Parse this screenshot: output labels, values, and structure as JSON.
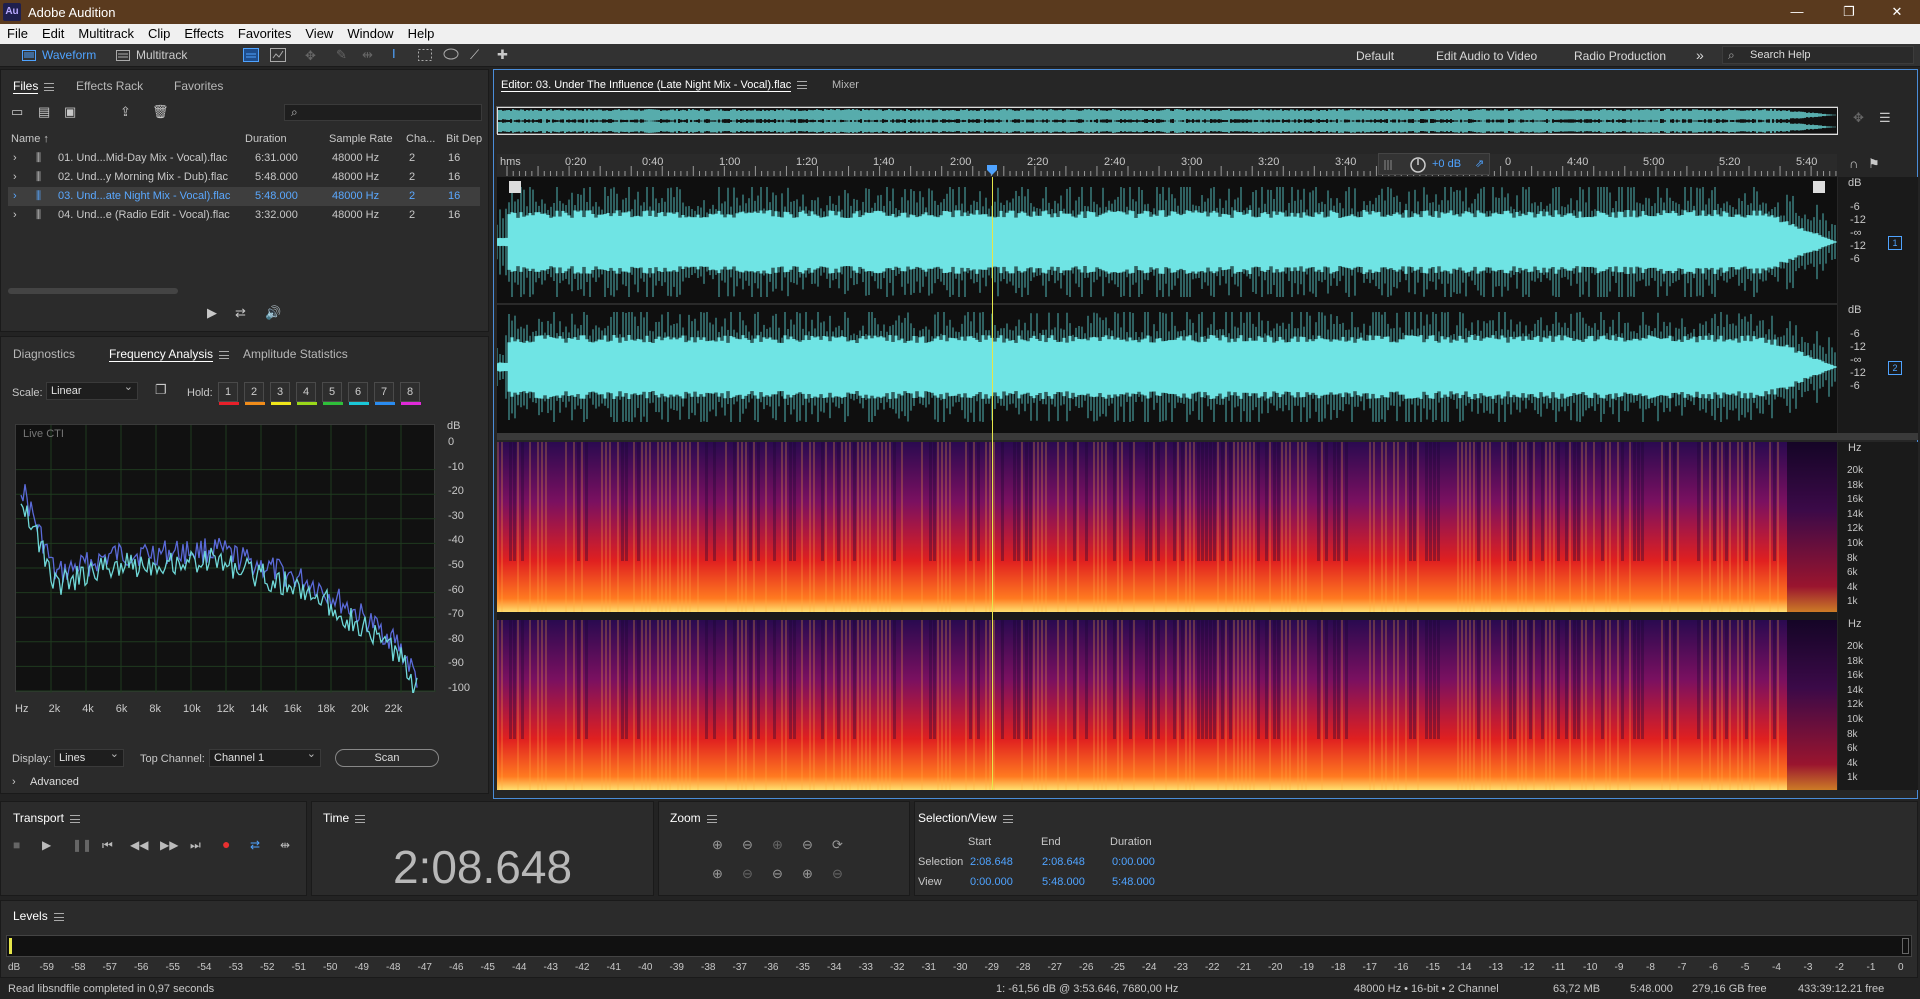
{
  "app": {
    "title": "Adobe Audition",
    "icon_text": "Au"
  },
  "window_controls": [
    "—",
    "❐",
    "✕"
  ],
  "menu": [
    "File",
    "Edit",
    "Multitrack",
    "Clip",
    "Effects",
    "Favorites",
    "View",
    "Window",
    "Help"
  ],
  "toolbar": {
    "waveform_label": "Waveform",
    "multitrack_label": "Multitrack",
    "workspaces": [
      "Default",
      "Edit Audio to Video",
      "Radio Production"
    ],
    "overflow": "»",
    "search_placeholder": "Search Help"
  },
  "files_panel": {
    "tabs": [
      "Files",
      "Effects Rack",
      "Favorites"
    ],
    "columns": [
      "Name ↑",
      "Duration",
      "Sample Rate",
      "Cha...",
      "Bit Dep"
    ],
    "rows": [
      {
        "name": "01. Und...Mid-Day Mix - Vocal).flac",
        "duration": "6:31.000",
        "rate": "48000 Hz",
        "ch": "2",
        "bits": "16",
        "selected": false
      },
      {
        "name": "02. Und...y Morning Mix - Dub).flac",
        "duration": "5:48.000",
        "rate": "48000 Hz",
        "ch": "2",
        "bits": "16",
        "selected": false
      },
      {
        "name": "03. Und...ate Night Mix - Vocal).flac",
        "duration": "5:48.000",
        "rate": "48000 Hz",
        "ch": "2",
        "bits": "16",
        "selected": true
      },
      {
        "name": "04. Und...e (Radio Edit - Vocal).flac",
        "duration": "3:32.000",
        "rate": "48000 Hz",
        "ch": "2",
        "bits": "16",
        "selected": false
      }
    ]
  },
  "analysis_panel": {
    "tabs": [
      "Diagnostics",
      "Frequency Analysis",
      "Amplitude Statistics"
    ],
    "scale_label": "Scale:",
    "scale_value": "Linear",
    "hold_label": "Hold:",
    "hold_buttons": [
      "1",
      "2",
      "3",
      "4",
      "5",
      "6",
      "7",
      "8"
    ],
    "hold_colors": [
      "#e8202a",
      "#f08c1a",
      "#f0e61a",
      "#9ad81a",
      "#2fbf3a",
      "#1ac8d8",
      "#2a8cf0",
      "#e02ad8"
    ],
    "live_label": "Live CTI",
    "db_unit": "dB",
    "db_ticks": [
      "0",
      "-10",
      "-20",
      "-30",
      "-40",
      "-50",
      "-60",
      "-70",
      "-80",
      "-90",
      "-100"
    ],
    "hz_ticks": [
      "Hz",
      "2k",
      "4k",
      "6k",
      "8k",
      "10k",
      "12k",
      "14k",
      "16k",
      "18k",
      "20k",
      "22k"
    ],
    "display_label": "Display:",
    "display_value": "Lines",
    "top_channel_label": "Top Channel:",
    "top_channel_value": "Channel 1",
    "scan_label": "Scan",
    "advanced_label": "Advanced"
  },
  "editor": {
    "tab": "Editor: 03. Under The Influence (Late Night Mix - Vocal).flac",
    "mixer_tab": "Mixer",
    "ruler_unit": "hms",
    "ruler": [
      "0:20",
      "0:40",
      "1:00",
      "1:20",
      "1:40",
      "2:00",
      "2:20",
      "2:40",
      "3:00",
      "3:20",
      "3:40",
      "0",
      "4:40",
      "5:00",
      "5:20",
      "5:40"
    ],
    "gain": "+0 dB",
    "db_unit": "dB",
    "db_scale": [
      "-6",
      "-12",
      "-∞",
      "-12",
      "-6"
    ],
    "channel_badges": [
      "1",
      "2"
    ],
    "hz_unit": "Hz",
    "hz_scale": [
      "20k",
      "18k",
      "16k",
      "14k",
      "12k",
      "10k",
      "8k",
      "6k",
      "4k",
      "1k"
    ]
  },
  "transport": {
    "title": "Transport"
  },
  "time_panel": {
    "title": "Time",
    "value": "2:08.648"
  },
  "zoom_panel": {
    "title": "Zoom"
  },
  "selection_view": {
    "title": "Selection/View",
    "headers": [
      "Start",
      "End",
      "Duration"
    ],
    "rows": [
      {
        "label": "Selection",
        "start": "2:08.648",
        "end": "2:08.648",
        "duration": "0:00.000"
      },
      {
        "label": "View",
        "start": "0:00.000",
        "end": "5:48.000",
        "duration": "5:48.000"
      }
    ]
  },
  "levels": {
    "title": "Levels",
    "scale": [
      "dB",
      "-59",
      "-58",
      "-57",
      "-56",
      "-55",
      "-54",
      "-53",
      "-52",
      "-51",
      "-50",
      "-49",
      "-48",
      "-47",
      "-46",
      "-45",
      "-44",
      "-43",
      "-42",
      "-41",
      "-40",
      "-39",
      "-38",
      "-37",
      "-36",
      "-35",
      "-34",
      "-33",
      "-32",
      "-31",
      "-30",
      "-29",
      "-28",
      "-27",
      "-26",
      "-25",
      "-24",
      "-23",
      "-22",
      "-21",
      "-20",
      "-19",
      "-18",
      "-17",
      "-16",
      "-15",
      "-14",
      "-13",
      "-12",
      "-11",
      "-10",
      "-9",
      "-8",
      "-7",
      "-6",
      "-5",
      "-4",
      "-3",
      "-2",
      "-1",
      "0"
    ]
  },
  "status": {
    "message": "Read libsndfile completed in 0,97 seconds",
    "cursor": "1: -61,56 dB @ 3:53.646, 7680,00 Hz",
    "format": "48000 Hz • 16-bit • 2 Channel",
    "size": "63,72 MB",
    "duration": "5:48.000",
    "free": "279,16 GB free",
    "free_time": "433:39:12.21 free"
  }
}
